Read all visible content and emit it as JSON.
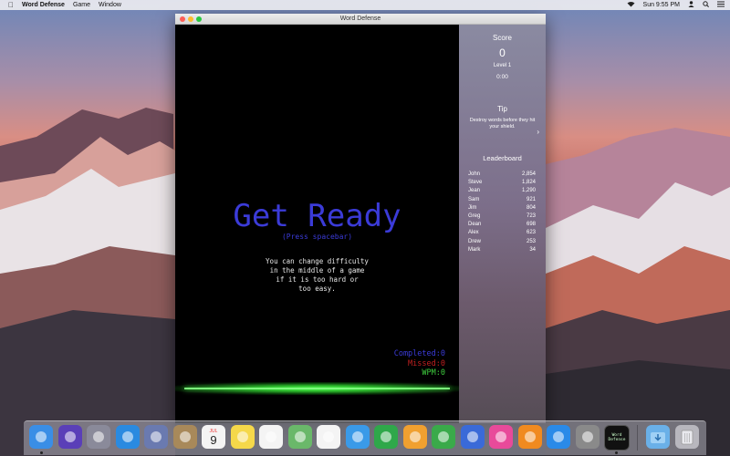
{
  "menubar": {
    "app_name": "Word Defense",
    "menus": [
      "Game",
      "Window"
    ],
    "clock": "Sun 9:55 PM"
  },
  "window": {
    "title": "Word Defense"
  },
  "game": {
    "headline": "Get Ready",
    "prompt": "(Press spacebar)",
    "hint_lines": [
      "You can change difficulty",
      "in the middle of a game",
      "if it is too hard or",
      "too easy."
    ],
    "completed": "Completed:0",
    "missed": "Missed:0",
    "wpm": "WPM:0"
  },
  "sidebar": {
    "score_heading": "Score",
    "score_value": "0",
    "level": "Level 1",
    "time": "0:00",
    "tip_heading": "Tip",
    "tip_text": "Destroy words before they hit your shield.",
    "leaderboard_heading": "Leaderboard",
    "leaderboard": [
      {
        "name": "John",
        "score": "2,854"
      },
      {
        "name": "Steve",
        "score": "1,824"
      },
      {
        "name": "Jean",
        "score": "1,290"
      },
      {
        "name": "Sam",
        "score": "921"
      },
      {
        "name": "Jim",
        "score": "804"
      },
      {
        "name": "Greg",
        "score": "723"
      },
      {
        "name": "Dean",
        "score": "698"
      },
      {
        "name": "Alex",
        "score": "623"
      },
      {
        "name": "Drew",
        "score": "253"
      },
      {
        "name": "Mark",
        "score": "34"
      }
    ]
  },
  "dock": {
    "apps": [
      {
        "name": "finder-icon",
        "color": "#3a8ee6"
      },
      {
        "name": "siri-icon",
        "color": "#5a3fb8"
      },
      {
        "name": "launchpad-icon",
        "color": "#8a8a9a"
      },
      {
        "name": "safari-icon",
        "color": "#2a8ae0"
      },
      {
        "name": "preview-icon",
        "color": "#6a7ab0"
      },
      {
        "name": "contacts-icon",
        "color": "#a8895a"
      },
      {
        "name": "calendar-icon",
        "color": "#f4f4f4"
      },
      {
        "name": "notes-icon",
        "color": "#f5d84a"
      },
      {
        "name": "reminders-icon",
        "color": "#f4f4f4"
      },
      {
        "name": "maps-icon",
        "color": "#6ab86a"
      },
      {
        "name": "photos-icon",
        "color": "#f4f4f4"
      },
      {
        "name": "messages-icon",
        "color": "#3a9ae8"
      },
      {
        "name": "facetime-icon",
        "color": "#2fa84a"
      },
      {
        "name": "pages-icon",
        "color": "#f0a030"
      },
      {
        "name": "numbers-icon",
        "color": "#3aaa4a"
      },
      {
        "name": "keynote-icon",
        "color": "#3a6ad8"
      },
      {
        "name": "itunes-icon",
        "color": "#e84a9a"
      },
      {
        "name": "ibooks-icon",
        "color": "#f08a20"
      },
      {
        "name": "app-store-icon",
        "color": "#2a8ae8"
      },
      {
        "name": "system-preferences-icon",
        "color": "#8a8a8a"
      },
      {
        "name": "word-defense-icon",
        "color": "#111111"
      }
    ],
    "dock_word_defense_label_1": "Word",
    "dock_word_defense_label_2": "Defense",
    "calendar_day": "9",
    "calendar_month": "JUL"
  }
}
